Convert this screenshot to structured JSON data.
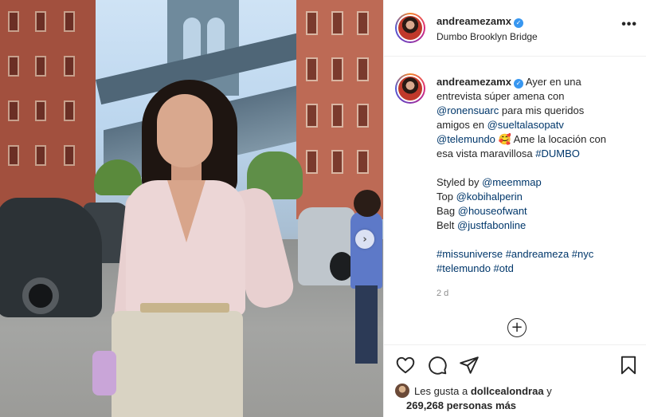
{
  "post": {
    "next_button_label": "›",
    "header": {
      "username": "andreamezamx",
      "verified_mark": "✓",
      "location": "Dumbo Brooklyn Bridge",
      "more_label": "•••"
    },
    "caption": {
      "username": "andreamezamx",
      "verified_mark": "✓",
      "lines": {
        "l1a": "Ayer en una",
        "l2": "entrevista súper amena con",
        "l3_link": "@ronensuarc",
        "l3_text": " para mis queridos",
        "l4_text": "amigos en ",
        "l4_link": "@sueltalasopatv",
        "l5_link": "@telemundo",
        "l5_text": " 🥰  Ame la locación con",
        "l6_text": "esa vista maravillosa ",
        "l6_link": "#DUMBO",
        "styled_text": "Styled by ",
        "styled_link": "@meemmap",
        "top_text": "Top ",
        "top_link": "@kobihalperin",
        "bag_text": "Bag ",
        "bag_link": "@houseofwant",
        "belt_text": "Belt ",
        "belt_link": "@justfabonline",
        "tags1": "#missuniverse #andreameza #nyc",
        "tags2": "#telemundo #otd"
      },
      "timestamp": "2 d",
      "load_more_label": "+"
    },
    "likes": {
      "prefix": "Les gusta a ",
      "liker": "dollcealondraa",
      "joiner": " y",
      "count": "269,268 personas más"
    }
  },
  "icons": {
    "like": "heart-icon",
    "comment": "comment-icon",
    "share": "share-icon",
    "save": "bookmark-icon"
  }
}
